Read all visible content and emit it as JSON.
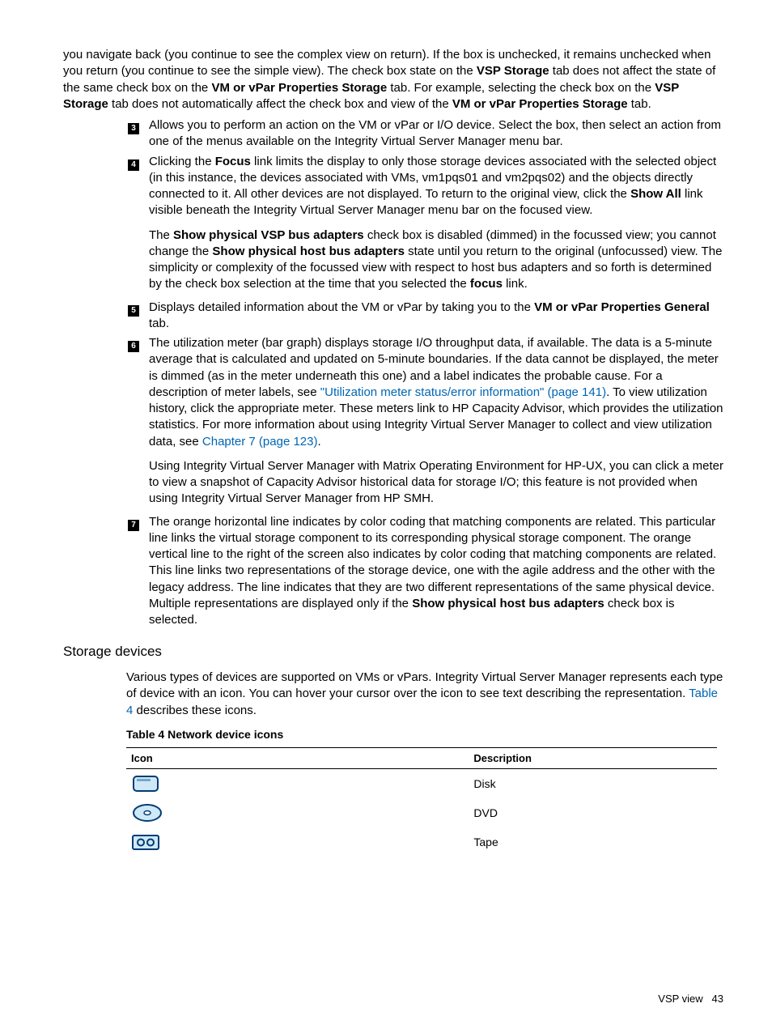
{
  "intro_para": {
    "t1": "you navigate back (you continue to see the complex view on return). If the box is unchecked, it remains unchecked when you return (you continue to see the simple view). The check box state on the ",
    "b1": "VSP Storage",
    "t2": " tab does not affect the state of the same check box on the ",
    "b2": "VM or vPar Properties Storage",
    "t3": " tab. For example, selecting the check box on the ",
    "b3": "VSP Storage",
    "t4": " tab does not automatically affect the check box and view of the ",
    "b4": "VM or vPar Properties Storage",
    "t5": " tab."
  },
  "items": {
    "3": {
      "num": "3",
      "text": "Allows you to perform an action on the VM or vPar or I/O device. Select the box, then select an action from one of the menus available on the Integrity Virtual Server Manager menu bar."
    },
    "4": {
      "num": "4",
      "p1": {
        "t1": "Clicking the ",
        "b1": "Focus",
        "t2": " link limits the display to only those storage devices associated with the selected object (in this instance, the devices associated with VMs, vm1pqs01 and vm2pqs02) and the objects directly connected to it. All other devices are not displayed. To return to the original view, click the ",
        "b2": "Show All",
        "t3": " link visible beneath the Integrity Virtual Server Manager menu bar on the focused view."
      },
      "p2": {
        "t1": "The ",
        "b1": "Show physical VSP bus adapters",
        "t2": " check box is disabled (dimmed) in the focussed view; you cannot change the ",
        "b2": "Show physical host bus adapters",
        "t3": " state until you return to the original (unfocussed) view. The simplicity or complexity of the focussed view with respect to host bus adapters and so forth is determined by the check box selection at the time that you selected the ",
        "b3": "focus",
        "t4": " link."
      }
    },
    "5": {
      "num": "5",
      "t1": "Displays detailed information about the VM or vPar by taking you to the ",
      "b1": "VM or vPar Properties General",
      "t2": " tab."
    },
    "6": {
      "num": "6",
      "p1": {
        "t1": "The utilization meter (bar graph) displays storage I/O throughput data, if available. The data is a 5-minute average that is calculated and updated on 5-minute boundaries. If the data cannot be displayed, the meter is dimmed (as in the meter underneath this one) and a label indicates the probable cause. For a description of meter labels, see ",
        "l1": "\"Utilization meter status/error information\" (page 141)",
        "t2": ". To view utilization history, click the appropriate meter. These meters link to HP Capacity Advisor, which provides the utilization statistics. For more information about using Integrity Virtual Server Manager to collect and view utilization data, see ",
        "l2": "Chapter 7 (page 123)",
        "t3": "."
      },
      "p2": "Using Integrity Virtual Server Manager with Matrix Operating Environment for HP-UX, you can click a meter to view a snapshot of Capacity Advisor historical data for storage I/O; this feature is not provided when using Integrity Virtual Server Manager from HP SMH."
    },
    "7": {
      "num": "7",
      "t1": "The orange horizontal line indicates by color coding that matching components are related. This particular line links the virtual storage component to its corresponding physical storage component. The orange vertical line to the right of the screen also indicates by color coding that matching components are related. This line links two representations of the storage device, one with the agile address and the other with the legacy address. The line indicates that they are two different representations of the same physical device. Multiple representations are displayed only if the ",
      "b1": "Show physical host bus adapters",
      "t2": " check box is selected."
    }
  },
  "storage": {
    "heading": "Storage devices",
    "intro": {
      "t1": "Various types of devices are supported on VMs or vPars. Integrity Virtual Server Manager represents each type of device with an icon. You can hover your cursor over the icon to see text describing the representation. ",
      "l1": "Table 4",
      "t2": " describes these icons."
    },
    "table_caption": "Table 4 Network device icons",
    "col1": "Icon",
    "col2": "Description",
    "rows": [
      {
        "desc": "Disk"
      },
      {
        "desc": "DVD"
      },
      {
        "desc": "Tape"
      }
    ]
  },
  "footer": {
    "section": "VSP view",
    "page": "43"
  }
}
